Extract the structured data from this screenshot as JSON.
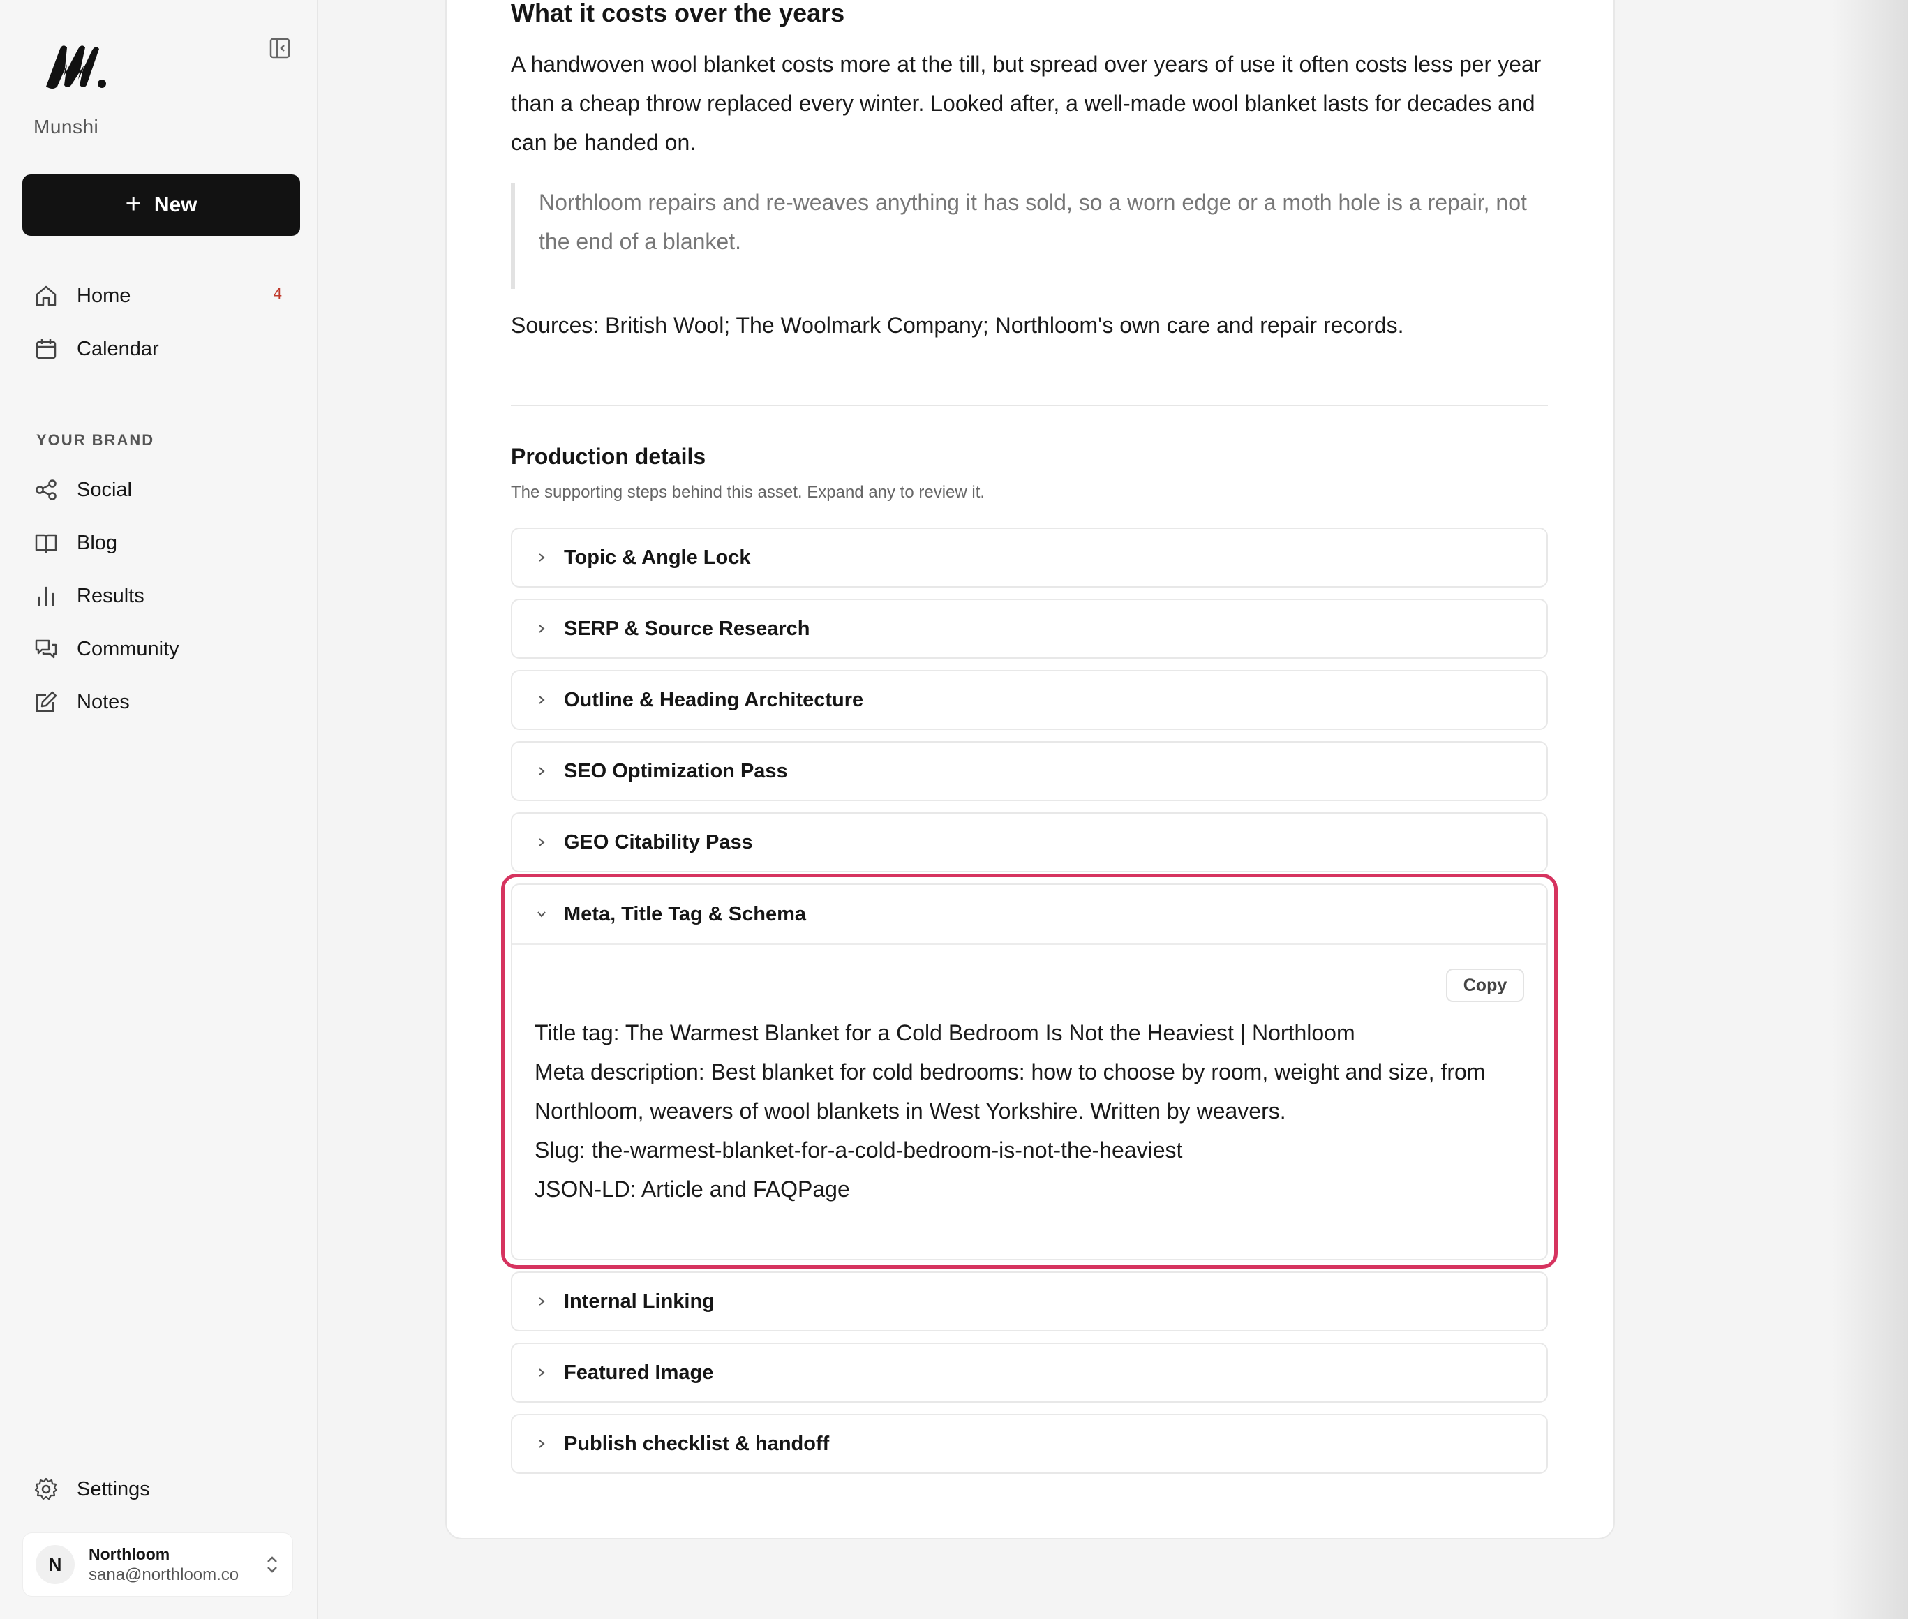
{
  "sidebar": {
    "brand": "Munshi",
    "new_label": "New",
    "nav": [
      {
        "label": "Home",
        "badge": "4"
      },
      {
        "label": "Calendar"
      }
    ],
    "section_label": "YOUR BRAND",
    "brand_nav": [
      {
        "label": "Social"
      },
      {
        "label": "Blog"
      },
      {
        "label": "Results"
      },
      {
        "label": "Community"
      },
      {
        "label": "Notes"
      }
    ],
    "settings_label": "Settings",
    "account": {
      "initial": "N",
      "name": "Northloom",
      "email": "sana@northloom.co"
    }
  },
  "article": {
    "section_heading": "What it costs over the years",
    "paragraph": "A handwoven wool blanket costs more at the till, but spread over years of use it often costs less per year than a cheap throw replaced every winter. Looked after, a well-made wool blanket lasts for decades and can be handed on.",
    "quote": "Northloom repairs and re-weaves anything it has sold, so a worn edge or a moth hole is a repair, not the end of a blanket.",
    "sources": "Sources: British Wool; The Woolmark Company; Northloom's own care and repair records."
  },
  "production": {
    "title": "Production details",
    "subtitle": "The supporting steps behind this asset. Expand any to review it.",
    "steps": [
      "Topic & Angle Lock",
      "SERP & Source Research",
      "Outline & Heading Architecture",
      "SEO Optimization Pass",
      "GEO Citability Pass",
      "Meta, Title Tag & Schema",
      "Internal Linking",
      "Featured Image",
      "Publish checklist & handoff"
    ],
    "expanded": {
      "copy_label": "Copy",
      "title_tag": "Title tag: The Warmest Blanket for a Cold Bedroom Is Not the Heaviest | Northloom",
      "meta_description": "Meta description: Best blanket for cold bedrooms: how to choose by room, weight and size, from Northloom, weavers of wool blankets in West Yorkshire. Written by weavers.",
      "slug": "Slug: the-warmest-blanket-for-a-cold-bedroom-is-not-the-heaviest",
      "jsonld": "JSON-LD: Article and FAQPage"
    }
  },
  "colors": {
    "accent_highlight": "#d6335f",
    "primary_button": "#121212",
    "badge": "#c0392b"
  }
}
